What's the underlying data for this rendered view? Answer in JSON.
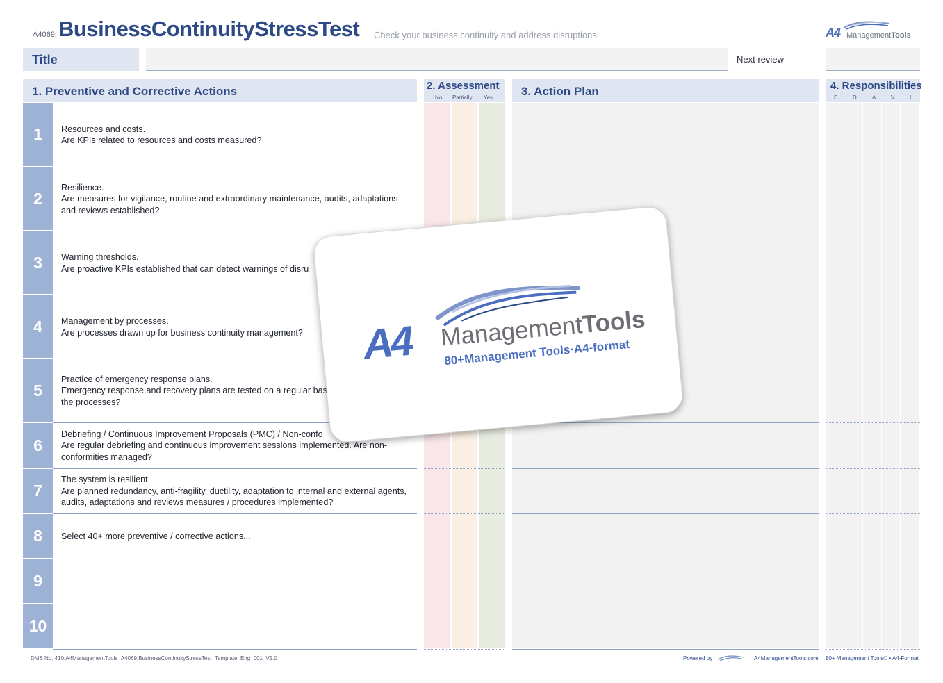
{
  "header": {
    "code": "A4069.",
    "title": "BusinessContinuityStressTest",
    "subtitle": "Check your business continuity and address disruptions",
    "brand_a4": "A4",
    "brand_mgmt": "Management",
    "brand_tools": "Tools"
  },
  "title_row": {
    "title_label": "Title",
    "title_value": "",
    "next_review_label": "Next review",
    "next_review_value": ""
  },
  "sections": {
    "s1": "1.  Preventive and Corrective Actions",
    "s2": "2. Assessment",
    "s2_cols": [
      "No",
      "Partially",
      "Yes"
    ],
    "s3": "3. Action Plan",
    "s4": "4. Responsibilities",
    "s4_cols": [
      "E",
      "D",
      "A",
      "V",
      "I"
    ]
  },
  "rows": [
    {
      "num": "1",
      "title": "Resources and costs.",
      "text": "Are KPIs related to resources and costs measured?"
    },
    {
      "num": "2",
      "title": "Resilience.",
      "text": "Are measures for vigilance, routine and extraordinary maintenance, audits, adaptations and reviews established?"
    },
    {
      "num": "3",
      "title": "Warning thresholds.",
      "text": "Are proactive KPIs established that can detect warnings of disru"
    },
    {
      "num": "4",
      "title": "Management by processes.",
      "text": "Are processes drawn up for business continuity management?"
    },
    {
      "num": "5",
      "title": "Practice of emergency response plans.",
      "text": "Emergency response and recovery plans are tested on a regular bas learnt integrated into the processes?"
    },
    {
      "num": "6",
      "title": "Debriefing / Continuous Improvement Proposals (PMC) / Non-confo",
      "text": "Are regular debriefing and continuous improvement sessions implemented. Are non-conformities managed?"
    },
    {
      "num": "7",
      "title": "The system is resilient.",
      "text": "Are planned redundancy, anti-fragility, ductility, adaptation to internal and external agents, audits, adaptations and reviews measures / procedures implemented?"
    },
    {
      "num": "8",
      "title": "Select 40+ more preventive / corrective actions...",
      "text": ""
    },
    {
      "num": "9",
      "title": "",
      "text": ""
    },
    {
      "num": "10",
      "title": "",
      "text": ""
    }
  ],
  "footer": {
    "dms": "DMS No. 410.A4ManagementTools_A4069.BusinessContinuityStressTest_Template_Eng_001_V1.0",
    "powered": "Powered by",
    "site": "A4ManagementTools.com",
    "tagline": "80+ Management Tools© • A4-Format"
  },
  "overlay": {
    "a4": "A4",
    "management": "Management",
    "tools": "Tools",
    "tagline": "80+Management Tools·A4-format"
  },
  "colors": {
    "accent": "#2e4a86",
    "number_cell": "#9eb2d6",
    "header_bg": "#dfe5f1",
    "no_col": "#f9e6e8",
    "partial_col": "#faefe2",
    "yes_col": "#e8ece0"
  }
}
